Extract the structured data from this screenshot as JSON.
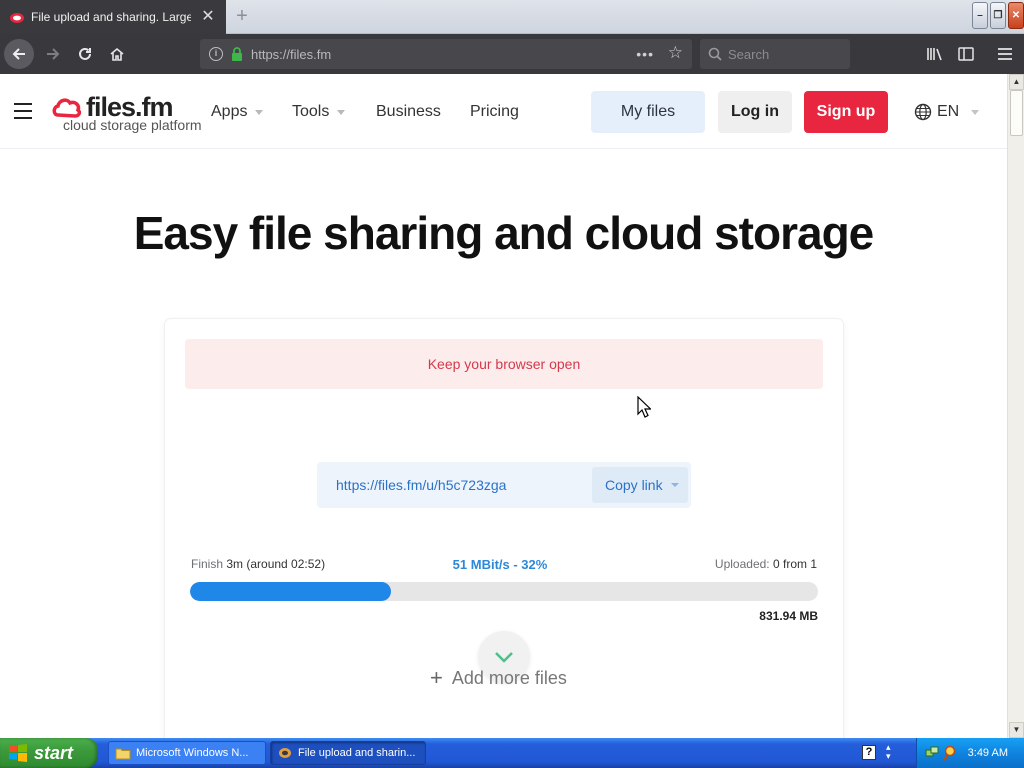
{
  "browser": {
    "tab_title": "File upload and sharing. Large file",
    "url": "https://files.fm",
    "search_placeholder": "Search"
  },
  "site": {
    "logo_name": "files.fm",
    "logo_tagline": "cloud storage platform",
    "menu": {
      "apps": "Apps",
      "tools": "Tools",
      "business": "Business",
      "pricing": "Pricing"
    },
    "my_files": "My files",
    "login": "Log in",
    "signup": "Sign up",
    "language": "EN",
    "brand_color": "#e8263f"
  },
  "hero": {
    "title": "Easy file sharing and cloud storage"
  },
  "upload": {
    "notice": "Keep your browser open",
    "share_link": "https://files.fm/u/h5c723zga",
    "copy_label": "Copy link",
    "finish_label": "Finish",
    "finish_value": "3m (around 02:52)",
    "speed": "51 MBit/s - 32%",
    "progress_percent": 32,
    "uploaded_label": "Uploaded:",
    "uploaded_value": "0 from 1",
    "size": "831.94 MB",
    "add_more": "Add more files"
  },
  "taskbar": {
    "start": "start",
    "tasks": [
      "Microsoft Windows N...",
      "File upload and sharin..."
    ],
    "clock": "3:49 AM"
  }
}
